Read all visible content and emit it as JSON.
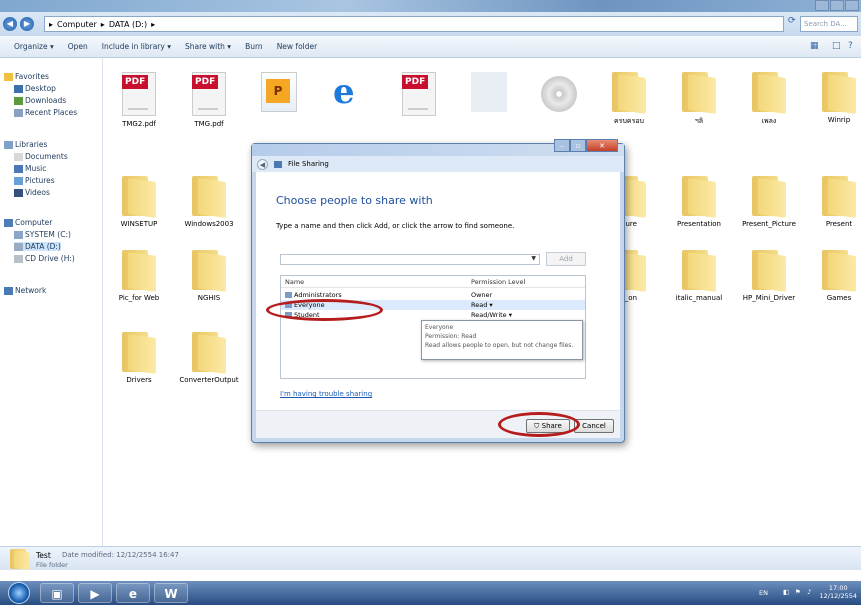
{
  "address": {
    "path": [
      "Computer",
      "DATA (D:)"
    ],
    "search_placeholder": "Search DA..."
  },
  "toolbar": [
    "Organize ▾",
    "Open",
    "Include in library ▾",
    "Share with ▾",
    "Burn",
    "New folder"
  ],
  "sidebar": {
    "favorites": {
      "title": "Favorites",
      "items": [
        "Desktop",
        "Downloads",
        "Recent Places"
      ]
    },
    "libraries": {
      "title": "Libraries",
      "items": [
        "Documents",
        "Music",
        "Pictures",
        "Videos"
      ]
    },
    "computer": {
      "title": "Computer",
      "items": [
        "SYSTEM (C:)",
        "DATA (D:)",
        "CD Drive (H:)"
      ]
    },
    "network": "Network"
  },
  "files": {
    "row1": [
      "TMG2.pdf",
      "TMG.pdf",
      "",
      "",
      "",
      "",
      "",
      "ครบครอบ",
      "ฯลิ",
      "เพลง",
      "Winrip"
    ],
    "row2": [
      "WINSETUP",
      "Windows2003",
      "uure",
      "Presentation",
      "Present_Picture",
      "Present"
    ],
    "row3": [
      "Pic_for Web",
      "NGHIS",
      "c_on",
      "italic_manual",
      "HP_Mini_Driver",
      "Games"
    ],
    "row4": [
      "Drivers",
      "ConverterOutput"
    ],
    "pdf_badge": "PDF"
  },
  "dialog": {
    "title": "File Sharing",
    "heading": "Choose people to share with",
    "instruction": "Type a name and then click Add, or click the arrow to find someone.",
    "add_label": "Add",
    "columns": {
      "name": "Name",
      "permission": "Permission Level"
    },
    "rows": [
      {
        "name": "Administrators",
        "permission": "Owner"
      },
      {
        "name": "Everyone",
        "permission": "Read ▾"
      },
      {
        "name": "Student",
        "permission": "Read/Write ▾"
      }
    ],
    "tooltip": [
      "Everyone",
      "Permission: Read",
      "Read allows people to open, but not change files."
    ],
    "help_link": "I'm having trouble sharing",
    "share_label": "Share",
    "cancel_label": "Cancel"
  },
  "details": {
    "name": "Test",
    "modified": "Date modified: 12/12/2554 16:47",
    "type": "File folder"
  },
  "taskbar": {
    "clock_time": "17:00",
    "clock_date": "12/12/2554",
    "lang": "EN"
  },
  "colors": {
    "highlight_ring": "#b51c1c",
    "folder": "#f3d77a",
    "taskbar": "#274c80"
  }
}
